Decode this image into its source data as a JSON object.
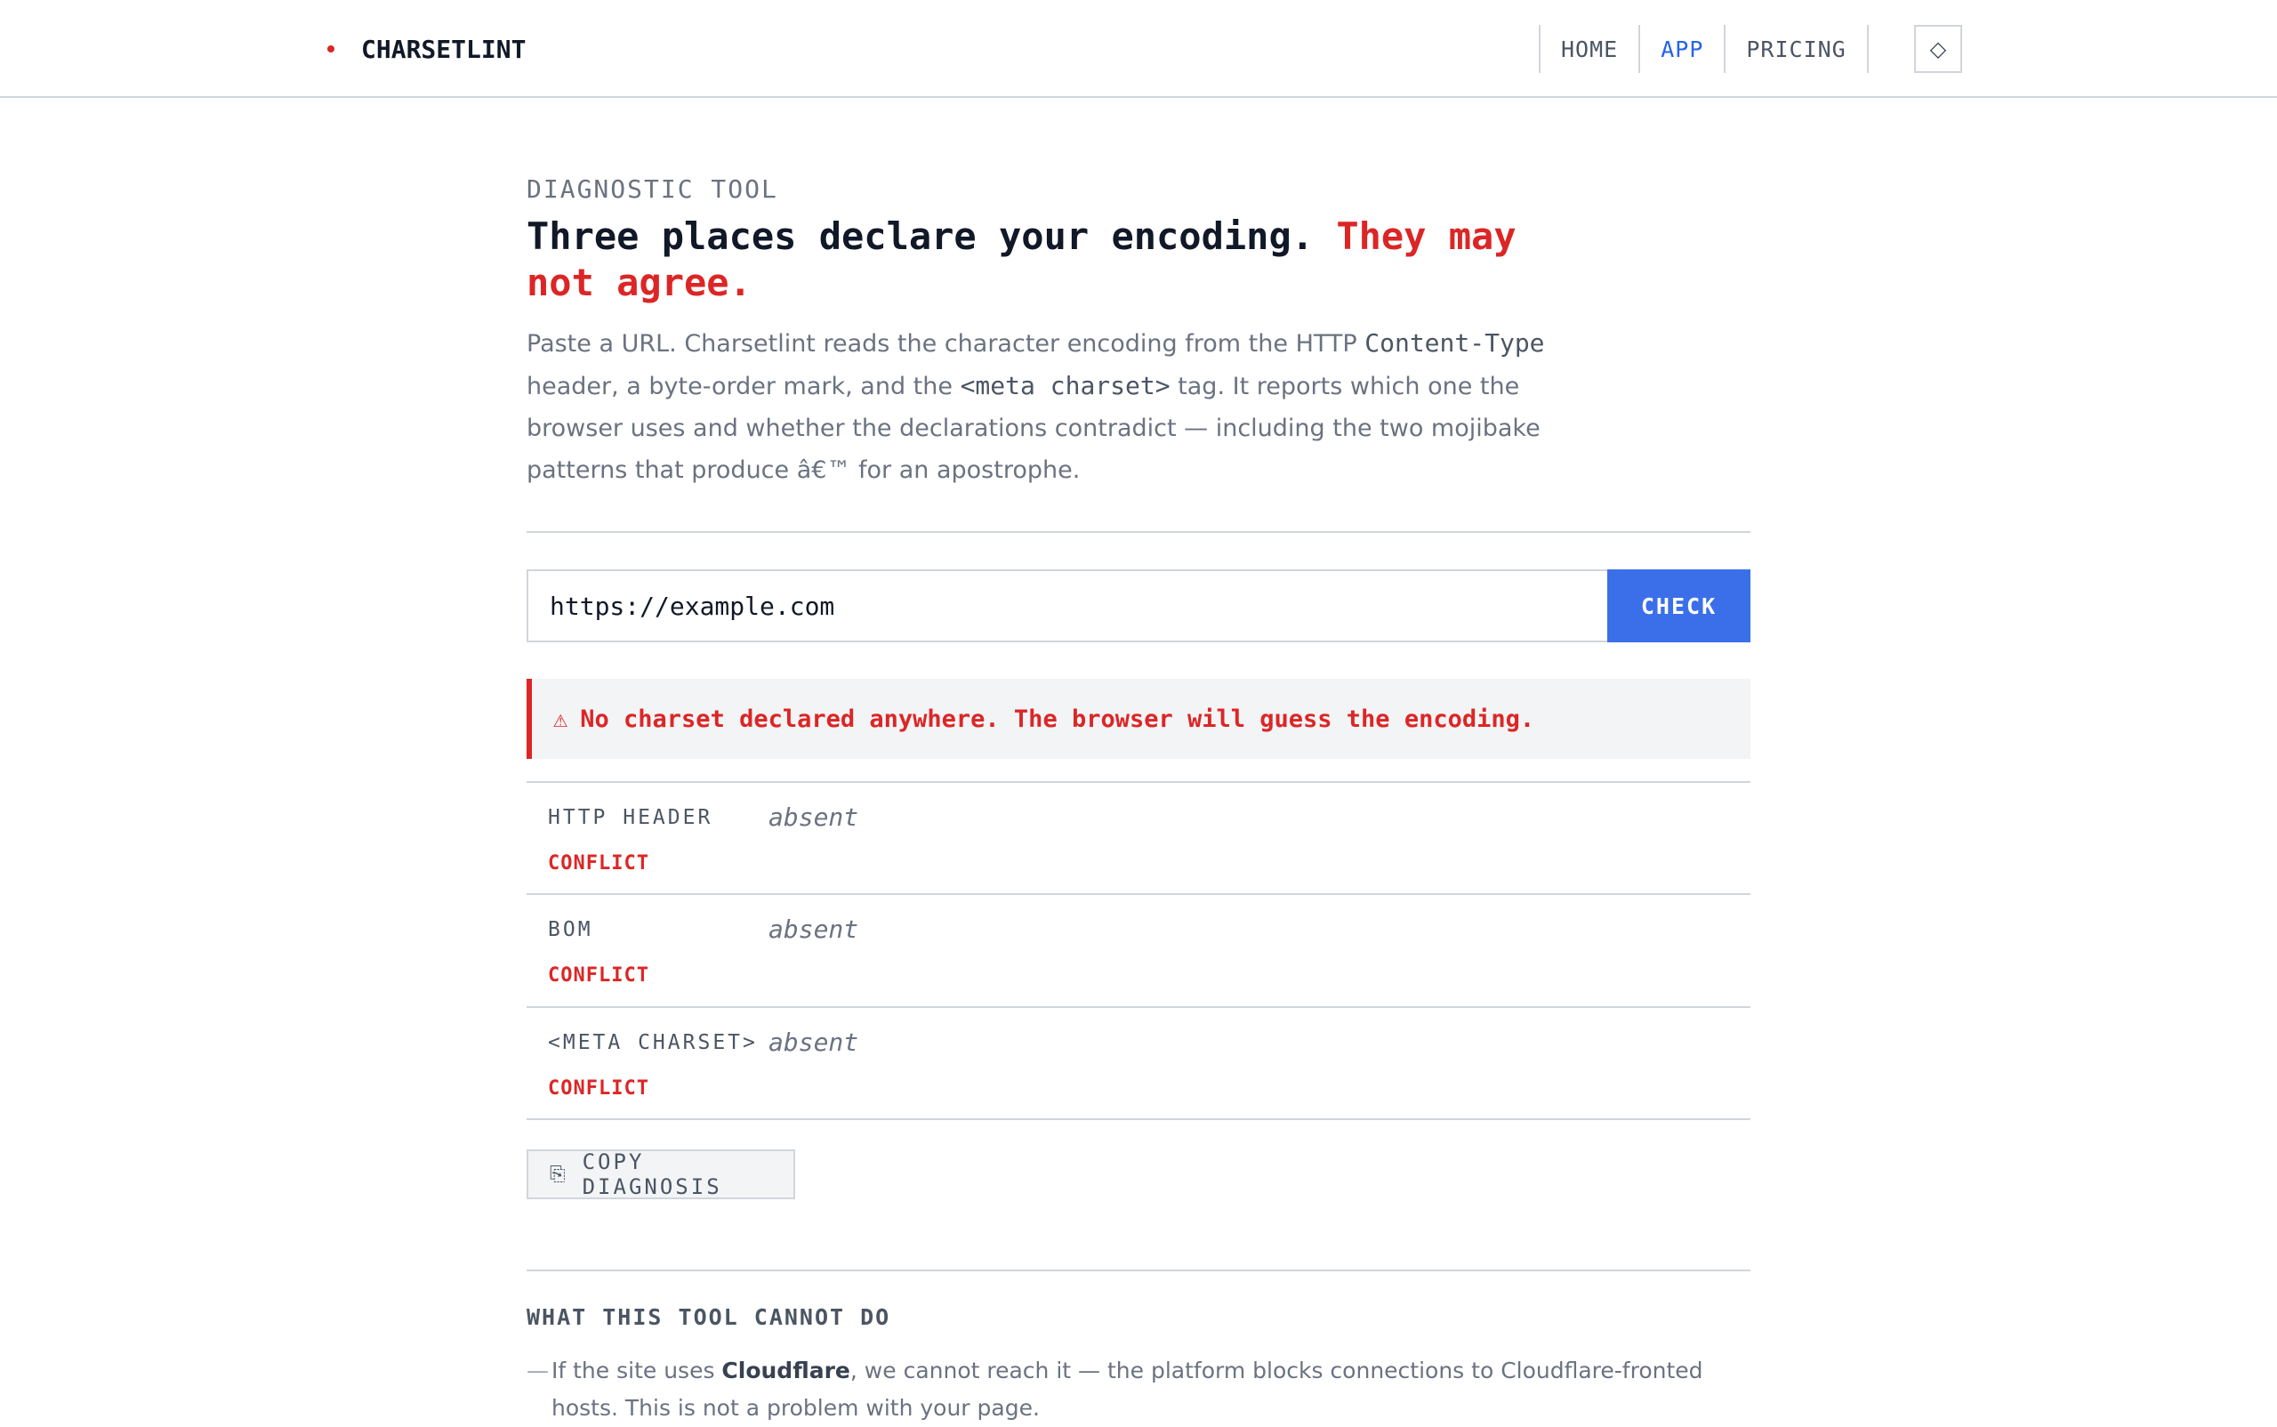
{
  "header": {
    "brand": "CHARSETLINT",
    "nav": [
      "HOME",
      "APP",
      "PRICING"
    ],
    "active_nav": "APP",
    "theme_toggle_icon": "◇"
  },
  "hero": {
    "eyebrow": "DIAGNOSTIC TOOL",
    "headline_main": "Three places declare your encoding.",
    "headline_accent": "They may not agree.",
    "lead": {
      "part1": "Paste a URL. Charsetlint reads the character encoding from the HTTP ",
      "code1": "Content-Type",
      "part2": " header, a byte-order mark, and the ",
      "code2": "<meta charset>",
      "part3": " tag. It reports which one the browser uses and whether the declarations contradict — including the two mojibake patterns that produce â€™ for an apostrophe."
    }
  },
  "form": {
    "url_value": "https://example.com",
    "check_label": "CHECK"
  },
  "warning": {
    "icon": "⚠",
    "text": "No charset declared anywhere. The browser will guess the encoding."
  },
  "results": [
    {
      "label": "HTTP HEADER",
      "value": "absent",
      "status": "CONFLICT"
    },
    {
      "label": "BOM",
      "value": "absent",
      "status": "CONFLICT"
    },
    {
      "label": "<META CHARSET>",
      "value": "absent",
      "status": "CONFLICT"
    }
  ],
  "copy": {
    "icon": "⎘",
    "label": "COPY DIAGNOSIS"
  },
  "limits": {
    "title": "WHAT THIS TOOL CANNOT DO",
    "items": [
      {
        "dash": "—",
        "before": "If the site uses ",
        "bold": "Cloudflare",
        "after": ", we cannot reach it — the platform blocks connections to Cloudflare-fronted hosts. This is not a problem with your page."
      }
    ]
  },
  "colors": {
    "accent_red": "#dc2626",
    "accent_blue": "#2563eb",
    "button_blue": "#3b6fea"
  }
}
